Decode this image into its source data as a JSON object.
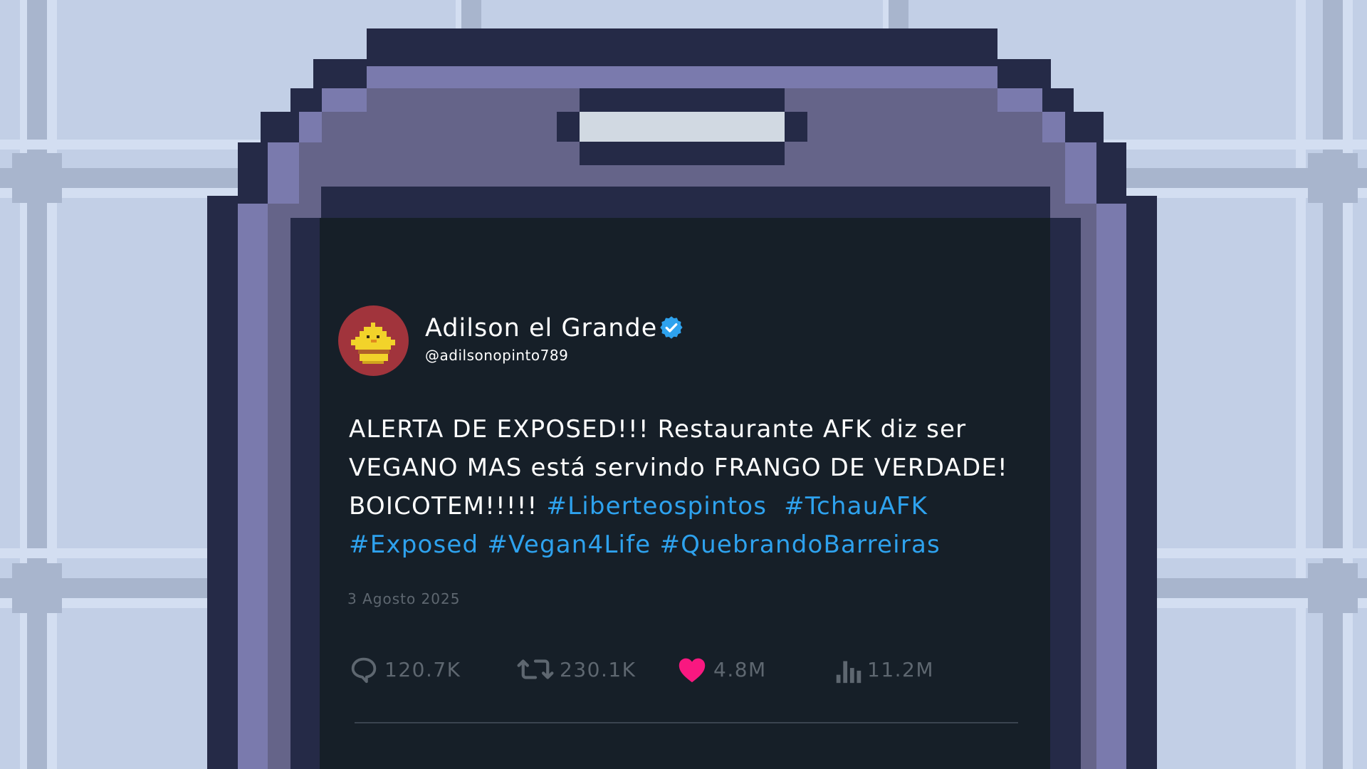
{
  "tweet": {
    "display_name": "Adilson el Grande",
    "handle": "@adilsonopinto789",
    "verified": true,
    "text_plain": "ALERTA DE EXPOSED!!! Restaurante AFK diz ser VEGANO MAS está servindo FRANGO DE VERDADE! BOICOTEM!!!!!",
    "hashtags": [
      "#Liberteospintos",
      "#TchauAFK",
      "#Exposed",
      "#Vegan4Life",
      "#QuebrandoBarreiras"
    ],
    "date": "3 Agosto 2025",
    "stats": {
      "replies": "120.7K",
      "retweets": "230.1K",
      "likes": "4.8M",
      "views": "11.2M"
    },
    "liked": true
  },
  "colors": {
    "background": "#c2cfe6",
    "phone_dark": "#252a47",
    "phone_lilac": "#7a7aad",
    "phone_mid": "#656489",
    "screen": "#161f28",
    "hashtag": "#2ea2ee",
    "verified_badge": "#2ea2ee",
    "like_active": "#f91880",
    "muted_text": "#5e6770",
    "avatar_bg": "#a1343c"
  },
  "icons": {
    "verified": "verified-badge-icon",
    "reply": "reply-icon",
    "retweet": "retweet-icon",
    "like": "heart-icon",
    "views": "views-chart-icon",
    "avatar": "yellow-chick-icon"
  }
}
